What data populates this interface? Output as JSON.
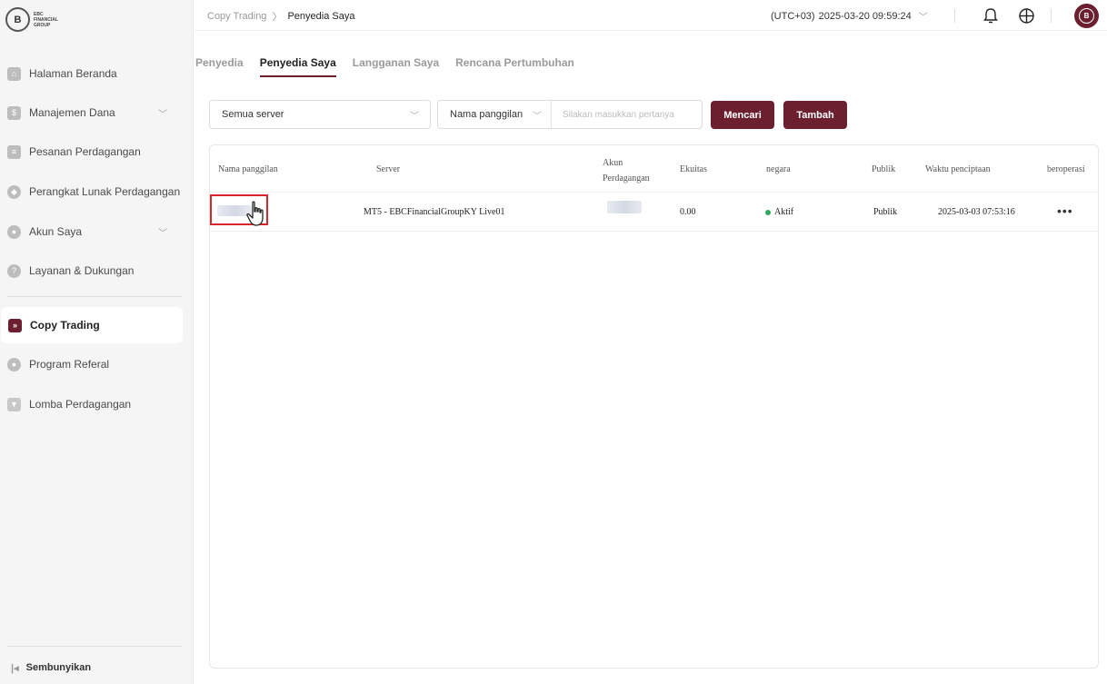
{
  "logo": {
    "mark": "B",
    "line1": "EBC",
    "line2": "FINANCIAL",
    "line3": "GROUP"
  },
  "sidebar": {
    "items": [
      {
        "label": "Halaman Beranda",
        "icon": "home-icon"
      },
      {
        "label": "Manajemen Dana",
        "icon": "wallet-icon",
        "expandable": true
      },
      {
        "label": "Pesanan Perdagangan",
        "icon": "orders-icon"
      },
      {
        "label": "Perangkat Lunak Perdagangan",
        "icon": "software-icon"
      },
      {
        "label": "Akun Saya",
        "icon": "user-icon",
        "expandable": true
      },
      {
        "label": "Layanan & Dukungan",
        "icon": "help-icon"
      },
      {
        "label": "Copy Trading",
        "icon": "copy-trading-icon",
        "active": true
      },
      {
        "label": "Program Referal",
        "icon": "referral-icon"
      },
      {
        "label": "Lomba Perdagangan",
        "icon": "trophy-icon"
      }
    ],
    "collapse_label": "Sembunyikan"
  },
  "header": {
    "breadcrumb": [
      "Copy Trading",
      "Penyedia Saya"
    ],
    "timezone": "(UTC+03)",
    "datetime": "2025-03-20 09:59:24"
  },
  "tabs": [
    {
      "label": "Penyedia",
      "active": false
    },
    {
      "label": "Penyedia Saya",
      "active": true
    },
    {
      "label": "Langganan Saya",
      "active": false
    },
    {
      "label": "Rencana Pertumbuhan",
      "active": false
    }
  ],
  "filters": {
    "server_select": "Semua server",
    "field_select": "Nama panggilan",
    "search_placeholder": "Silakan masukkan pertanya",
    "search_button": "Mencari",
    "add_button": "Tambah"
  },
  "table": {
    "columns": [
      "Nama panggilan",
      "Server",
      "Akun Perdagangan",
      "Ekuitas",
      "negara",
      "Publik",
      "Waktu penciptaan",
      "beroperasi"
    ],
    "rows": [
      {
        "nickname": "",
        "server": "MT5 - EBCFinancialGroupKY Live01",
        "account": "",
        "equity": "0.00",
        "status": "Aktif",
        "public": "Publik",
        "created": "2025-03-03 07:53:16",
        "actions": "•••"
      }
    ]
  },
  "colors": {
    "brand": "#6b1f2f",
    "active_status": "#2faa5c",
    "highlight": "#d9262e"
  }
}
